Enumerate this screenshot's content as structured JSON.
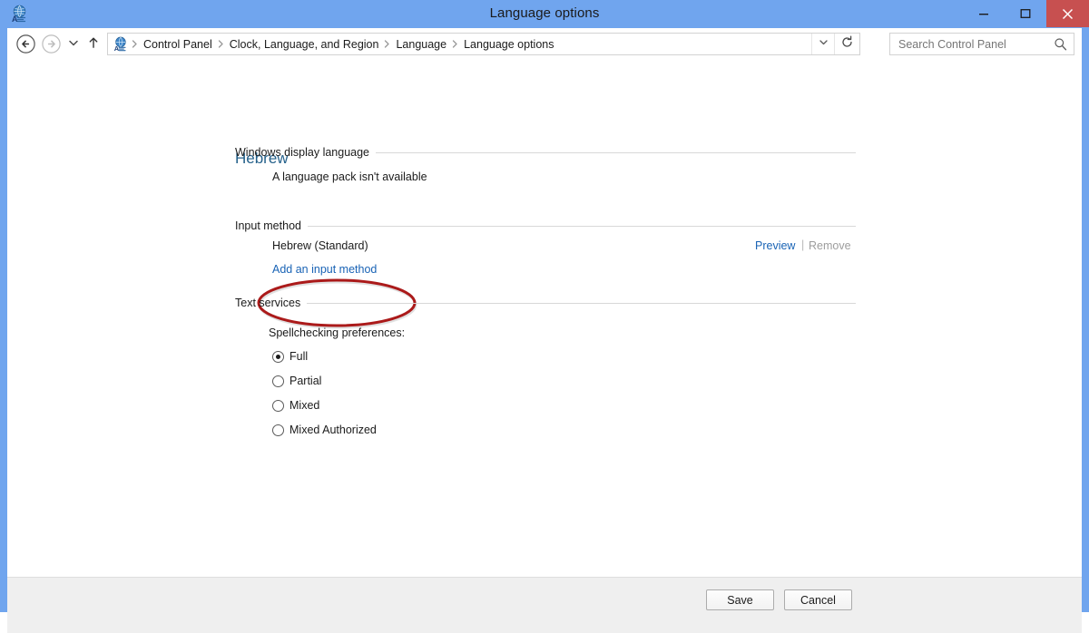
{
  "window": {
    "title": "Language options",
    "app_icon": "language-globe-icon",
    "frame_color": "#70a5ee",
    "controls": {
      "minimize": "minimize-icon",
      "maximize": "maximize-icon",
      "close": "close-icon",
      "close_color": "#c75050"
    }
  },
  "navbar": {
    "back": "back-arrow-icon",
    "forward": "forward-arrow-icon",
    "recent": "recent-pages-chevron-icon",
    "up": "up-arrow-icon",
    "address_icon": "language-globe-icon",
    "breadcrumbs": [
      "Control Panel",
      "Clock, Language, and Region",
      "Language",
      "Language options"
    ],
    "separator": "▸",
    "dropdown": "chevron-down-icon",
    "refresh": "refresh-icon"
  },
  "search": {
    "placeholder": "Search Control Panel",
    "value": "",
    "icon": "search-icon"
  },
  "page": {
    "title": "Hebrew",
    "title_color": "#25618b"
  },
  "sections": {
    "display_language": {
      "heading": "Windows display language",
      "status": "A language pack isn't available"
    },
    "input_method": {
      "heading": "Input method",
      "item_name": "Hebrew (Standard)",
      "preview_link": "Preview",
      "link_separator": "|",
      "remove_link": "Remove",
      "add_link": "Add an input method"
    },
    "text_services": {
      "heading": "Text services",
      "spell_label": "Spellchecking preferences:",
      "options": [
        {
          "label": "Full",
          "selected": true
        },
        {
          "label": "Partial",
          "selected": false
        },
        {
          "label": "Mixed",
          "selected": false
        },
        {
          "label": "Mixed Authorized",
          "selected": false
        }
      ]
    }
  },
  "annotation": {
    "shape": "red-ellipse-highlight",
    "color": "#ab1a1a",
    "target": "Add an input method"
  },
  "footer": {
    "save_label": "Save",
    "cancel_label": "Cancel"
  }
}
